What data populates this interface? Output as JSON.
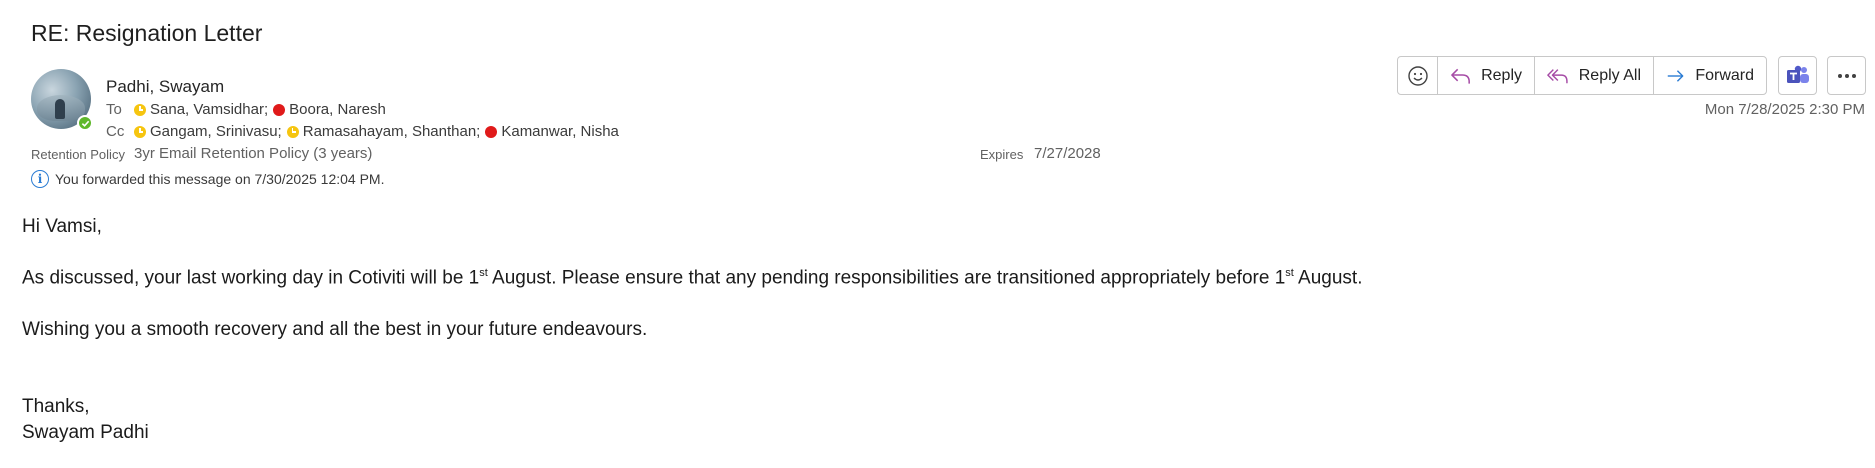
{
  "email": {
    "subject": "RE: Resignation Letter",
    "sender": "Padhi, Swayam",
    "to_label": "To",
    "to": [
      {
        "name": "Sana, Vamsidhar;",
        "status": "away"
      },
      {
        "name": "Boora, Naresh",
        "status": "busy"
      }
    ],
    "cc_label": "Cc",
    "cc": [
      {
        "name": "Gangam, Srinivasu;",
        "status": "away"
      },
      {
        "name": "Ramasahayam, Shanthan;",
        "status": "away"
      },
      {
        "name": "Kamanwar, Nisha",
        "status": "busy"
      }
    ],
    "retention_label": "Retention Policy",
    "retention_value": "3yr Email Retention Policy (3 years)",
    "expires_label": "Expires",
    "expires_value": "7/27/2028",
    "info_text": "You forwarded this message on 7/30/2025 12:04 PM.",
    "date": "Mon 7/28/2025 2:30 PM"
  },
  "actions": {
    "emoji_icon": "smiley-icon",
    "reply": "Reply",
    "reply_all": "Reply All",
    "forward": "Forward",
    "teams_icon": "teams-icon",
    "more_icon": "more-icon"
  },
  "body": {
    "greeting": "Hi Vamsi,",
    "p1_a": "As discussed, your last working day in Cotiviti will be 1",
    "p1_sup1": "st",
    "p1_b": " August. Please ensure that any pending responsibilities are transitioned appropriately before 1",
    "p1_sup2": "st",
    "p1_c": " August.",
    "p2": "Wishing you a smooth recovery and all the best in your future endeavours.",
    "sign_off": "Thanks,",
    "signature": "Swayam Padhi"
  },
  "colors": {
    "presence_available": "#5fb82b",
    "presence_away": "#f6c510",
    "presence_busy": "#e01a1a",
    "reply_accent": "#a64ca6",
    "forward_accent": "#2b7cd3",
    "teams_accent": "#4b53bc"
  }
}
